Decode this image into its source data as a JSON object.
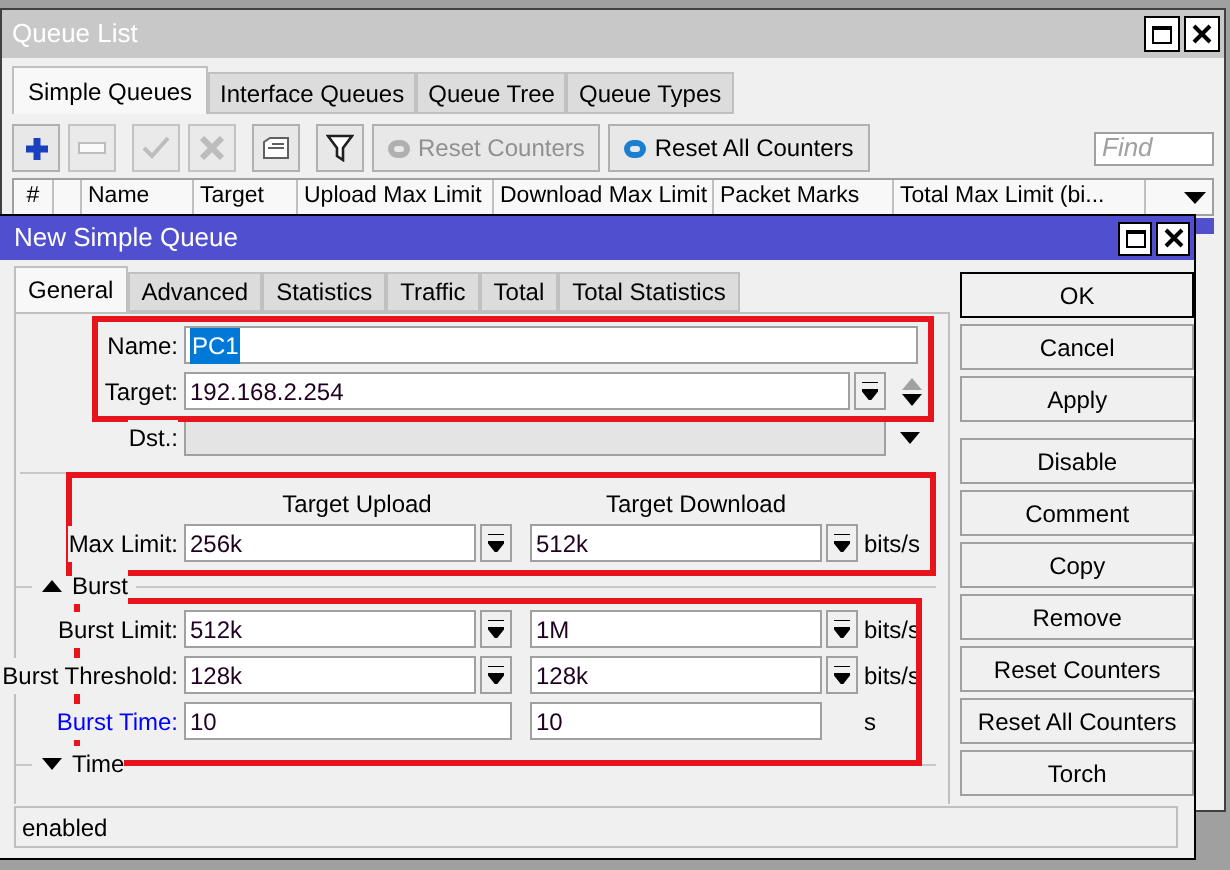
{
  "queue_list": {
    "title": "Queue List",
    "tabs": [
      {
        "label": "Simple Queues",
        "selected": true
      },
      {
        "label": "Interface Queues",
        "selected": false
      },
      {
        "label": "Queue Tree",
        "selected": false
      },
      {
        "label": "Queue Types",
        "selected": false
      }
    ],
    "toolbar": [
      {
        "kind": "add",
        "disabled": false
      },
      {
        "kind": "remove",
        "disabled": true
      },
      {
        "kind": "enable",
        "disabled": true
      },
      {
        "kind": "disable",
        "disabled": true
      },
      {
        "kind": "comment",
        "disabled": false
      },
      {
        "kind": "filter",
        "disabled": false
      },
      {
        "kind": "reset",
        "label": "Reset Counters",
        "disabled": true
      },
      {
        "kind": "reset",
        "label": "Reset All Counters",
        "disabled": false
      }
    ],
    "find_placeholder": "Find",
    "columns": [
      "#",
      "",
      "Name",
      "Target",
      "Upload Max Limit",
      "Download Max Limit",
      "Packet Marks",
      "Total Max Limit (bi..."
    ]
  },
  "dialog": {
    "title": "New Simple Queue",
    "tabs": [
      {
        "label": "General",
        "selected": true
      },
      {
        "label": "Advanced",
        "selected": false
      },
      {
        "label": "Statistics",
        "selected": false
      },
      {
        "label": "Traffic",
        "selected": false
      },
      {
        "label": "Total",
        "selected": false
      },
      {
        "label": "Total Statistics",
        "selected": false
      }
    ],
    "name": {
      "label": "Name:",
      "value": "PC1",
      "text_selected": true
    },
    "target": {
      "label": "Target:",
      "value": "192.168.2.254"
    },
    "dst": {
      "label": "Dst.:",
      "disabled": true
    },
    "column_headers": [
      "Target Upload",
      "Target Download"
    ],
    "max_limit": {
      "label": "Max Limit:",
      "kind": "dropdown",
      "upload": "256k",
      "download": "512k",
      "unit": "bits/s",
      "color": "#000000"
    },
    "sections": [
      {
        "label": "Burst",
        "expanded": true,
        "rows": [
          {
            "label": "Burst Limit:",
            "kind": "dropdown",
            "upload": "512k",
            "download": "1M",
            "unit": "bits/s",
            "color": "#000000"
          },
          {
            "label": "Burst Threshold:",
            "kind": "dropdown",
            "upload": "128k",
            "download": "128k",
            "unit": "bits/s",
            "color": "#000000"
          },
          {
            "label": "Burst Time:",
            "kind": "plain",
            "upload": "10",
            "download": "10",
            "unit": "s",
            "color": "#0000ff"
          }
        ]
      },
      {
        "label": "Time",
        "expanded": false
      }
    ],
    "buttons": [
      {
        "label": "OK",
        "default": true
      },
      {
        "label": "Cancel",
        "default": false
      },
      {
        "label": "Apply",
        "default": false
      },
      {
        "label": "Disable",
        "default": false
      },
      {
        "label": "Comment",
        "default": false
      },
      {
        "label": "Copy",
        "default": false
      },
      {
        "label": "Remove",
        "default": false
      },
      {
        "label": "Reset Counters",
        "default": false
      },
      {
        "label": "Reset All Counters",
        "default": false
      },
      {
        "label": "Torch",
        "default": false
      }
    ],
    "status": "enabled"
  }
}
